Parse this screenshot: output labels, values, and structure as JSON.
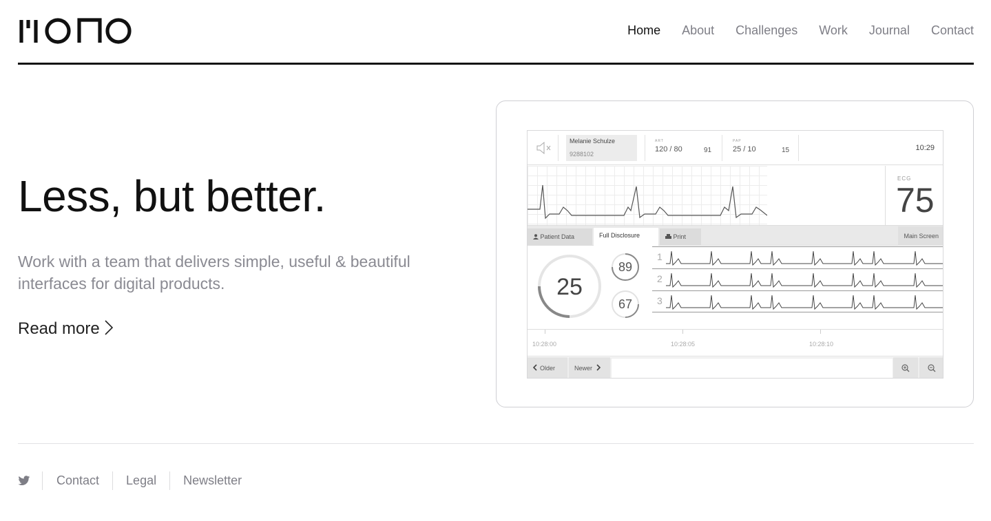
{
  "brand": {
    "logo_text": "mono",
    "logo_icon": "mono-wordmark-logo"
  },
  "nav": {
    "items": [
      {
        "label": "Home",
        "active": true
      },
      {
        "label": "About",
        "active": false
      },
      {
        "label": "Challenges",
        "active": false
      },
      {
        "label": "Work",
        "active": false
      },
      {
        "label": "Journal",
        "active": false
      },
      {
        "label": "Contact",
        "active": false
      }
    ]
  },
  "hero": {
    "title": "Less, but better.",
    "lead": "Work with a team that delivers simple, useful & beautiful interfaces for digital products.",
    "read_more": "Read more",
    "read_more_icon": "chevron-right-icon"
  },
  "monitor": {
    "patient_name": "Melanie Schulze",
    "patient_id": "9288102",
    "art_label": "ART",
    "art_value": "120 / 80",
    "art_mean": "91",
    "pap_label": "PAP",
    "pap_value": "25 / 10",
    "pap_mean": "15",
    "clock": "10:29",
    "ecg_label": "ECG",
    "ecg_value": "75",
    "tabs": {
      "patient_data": "Patient Data",
      "full_disclosure": "Full Disclosure",
      "print": "Print",
      "main_screen": "Main Screen"
    },
    "gauge_main": "25",
    "gauge_small_1": "89",
    "gauge_small_2": "67",
    "strips": [
      "1",
      "2",
      "3"
    ],
    "times": [
      "10:28:00",
      "10:28:05",
      "10:28:10"
    ],
    "older": "Older",
    "newer": "Newer",
    "icons": {
      "speaker": "speaker-muted-icon",
      "zoom_in": "zoom-in-icon",
      "zoom_out": "zoom-out-icon",
      "person": "person-icon",
      "printer": "printer-icon"
    }
  },
  "footer": {
    "twitter_icon": "twitter-icon",
    "links": [
      "Contact",
      "Legal",
      "Newsletter"
    ]
  },
  "colors": {
    "text": "#111111",
    "muted": "#7e7e86",
    "rule": "#111111"
  }
}
